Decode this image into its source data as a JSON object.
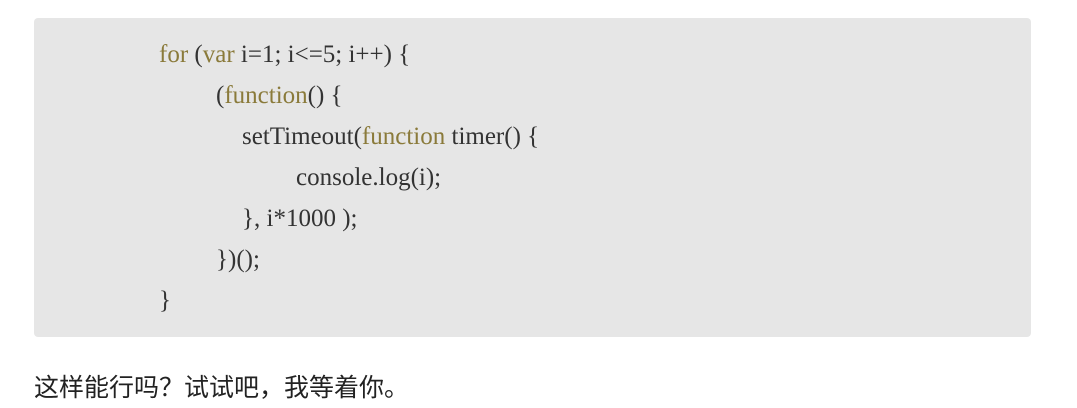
{
  "code": {
    "lines": [
      {
        "indent": 0,
        "tokens": [
          {
            "t": "for",
            "kw": true
          },
          {
            "t": " (",
            "kw": false
          },
          {
            "t": "var",
            "kw": true
          },
          {
            "t": " i=1; i<=5; i++) {",
            "kw": false
          }
        ]
      },
      {
        "indent": 1,
        "tokens": [
          {
            "t": "(",
            "kw": false
          },
          {
            "t": "function",
            "kw": true
          },
          {
            "t": "() {",
            "kw": false
          }
        ]
      },
      {
        "indent": 2,
        "tokens": [
          {
            "t": "setTimeout(",
            "kw": false
          },
          {
            "t": "function",
            "kw": true
          },
          {
            "t": " timer() {",
            "kw": false
          }
        ]
      },
      {
        "indent": 3,
        "tokens": [
          {
            "t": "console.log(i);",
            "kw": false
          }
        ]
      },
      {
        "indent": 2,
        "tokens": [
          {
            "t": "}, i*1000 );",
            "kw": false
          }
        ]
      },
      {
        "indent": 1,
        "tokens": [
          {
            "t": "})();",
            "kw": false
          }
        ]
      },
      {
        "indent": 0,
        "tokens": [
          {
            "t": "}",
            "kw": false
          }
        ]
      }
    ]
  },
  "prose": {
    "text": "这样能行吗？试试吧，我等着你。"
  }
}
